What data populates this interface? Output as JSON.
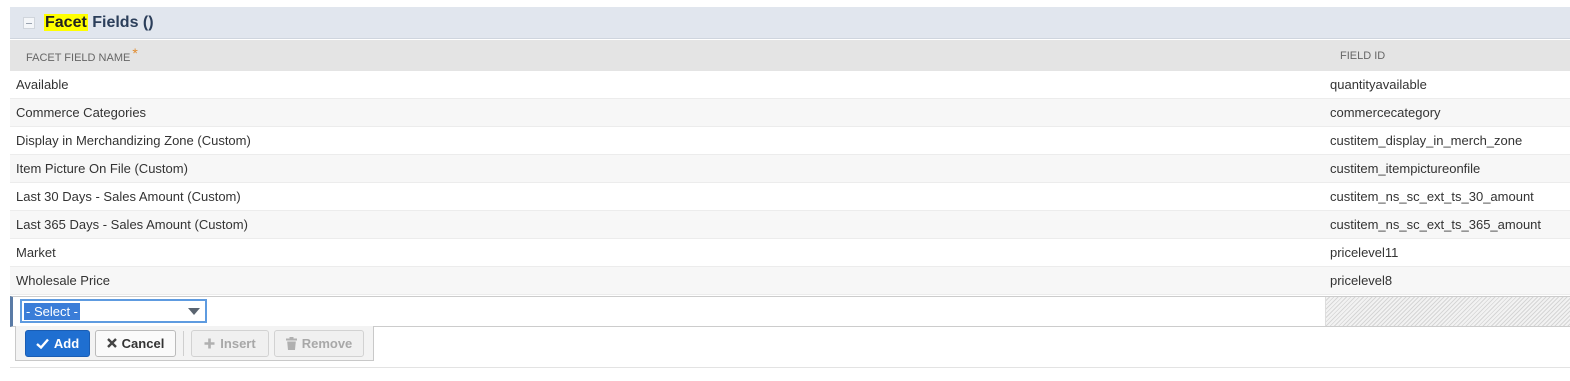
{
  "section": {
    "title_highlight": "Facet",
    "title_rest": " Fields ()"
  },
  "table": {
    "columns": {
      "name": "FACET FIELD NAME",
      "name_required_mark": "*",
      "id": "FIELD ID"
    },
    "rows": [
      {
        "name": "Available",
        "id": "quantityavailable"
      },
      {
        "name": "Commerce Categories",
        "id": "commercecategory"
      },
      {
        "name": "Display in Merchandizing Zone (Custom)",
        "id": "custitem_display_in_merch_zone"
      },
      {
        "name": "Item Picture On File (Custom)",
        "id": "custitem_itempictureonfile"
      },
      {
        "name": "Last 30 Days - Sales Amount (Custom)",
        "id": "custitem_ns_sc_ext_ts_30_amount"
      },
      {
        "name": "Last 365 Days - Sales Amount (Custom)",
        "id": "custitem_ns_sc_ext_ts_365_amount"
      },
      {
        "name": "Market",
        "id": "pricelevel11"
      },
      {
        "name": "Wholesale Price",
        "id": "pricelevel8"
      }
    ]
  },
  "editor": {
    "select_value": "- Select -"
  },
  "buttons": {
    "add": "Add",
    "cancel": "Cancel",
    "insert": "Insert",
    "remove": "Remove"
  },
  "colors": {
    "accent": "#1f6fd1",
    "header_bg": "#e1e6ee",
    "highlight": "#ffff00",
    "required": "#e08a2c"
  }
}
